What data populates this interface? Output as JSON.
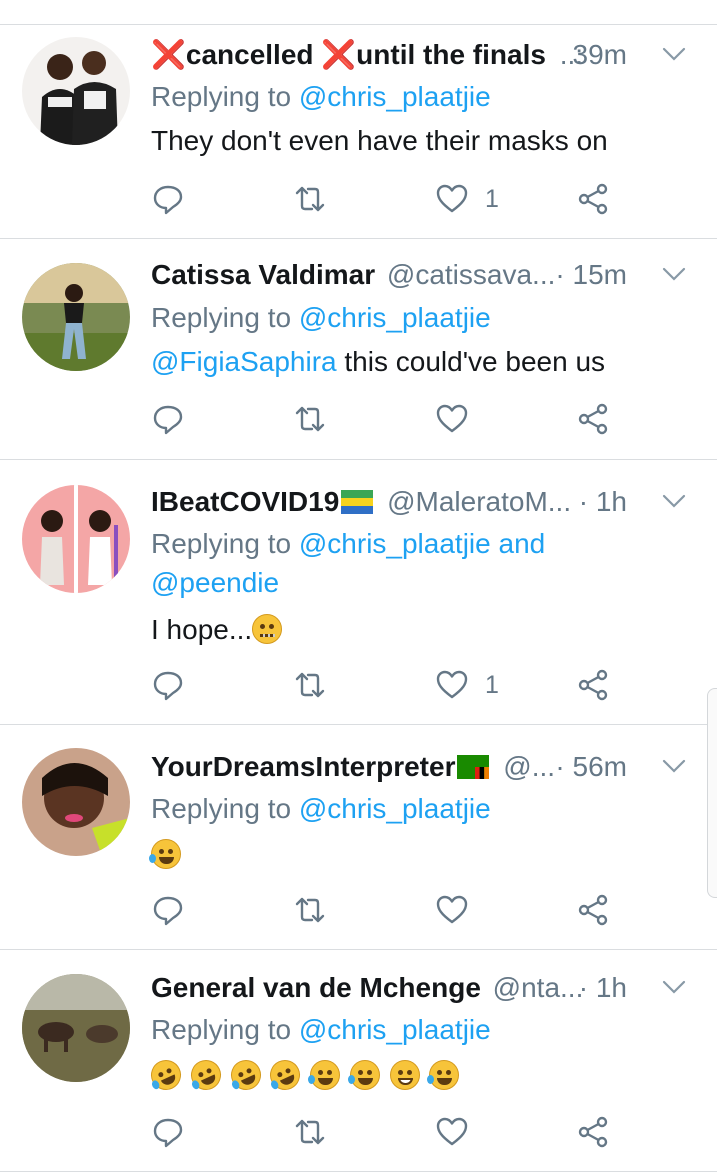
{
  "tweets": [
    {
      "name_prefix": "❌",
      "name_part1": "cancelled ",
      "name_part2": "❌",
      "name_part3": "until the finals",
      "handle": "..:",
      "time": "39m",
      "reply_prefix": "Replying to ",
      "reply_user": "@chris_plaatjie",
      "text": "They don't even have their masks on",
      "like_count": "1"
    },
    {
      "name": "Catissa Valdimar",
      "handle": "@catissava...",
      "time": "· 15m",
      "reply_prefix": "Replying to ",
      "reply_user": "@chris_plaatjie",
      "mention": "@FigiaSaphira",
      "text": " this could've been us"
    },
    {
      "name": "IBeatCOVID19",
      "handle": "@MaleratoM...",
      "time": "· 1h",
      "reply_prefix": "Replying to ",
      "reply_user": "@chris_plaatjie",
      "reply_and": " and",
      "reply_user2": "@peendie",
      "text": "I hope...",
      "like_count": "1"
    },
    {
      "name": "YourDreamsInterpreter",
      "handle": "@...",
      "time": "· 56m",
      "reply_prefix": "Replying to ",
      "reply_user": "@chris_plaatjie"
    },
    {
      "name": "General van de Mchenge",
      "handle": "@nta...",
      "time": "· 1h",
      "reply_prefix": "Replying to ",
      "reply_user": "@chris_plaatjie"
    }
  ],
  "icons": {
    "reply": "reply-icon",
    "retweet": "retweet-icon",
    "like": "heart-icon",
    "share": "share-icon",
    "menu": "chevron-down-icon"
  },
  "colors": {
    "link": "#1da1f2",
    "secondary": "#657786",
    "divider": "#dadde0"
  }
}
